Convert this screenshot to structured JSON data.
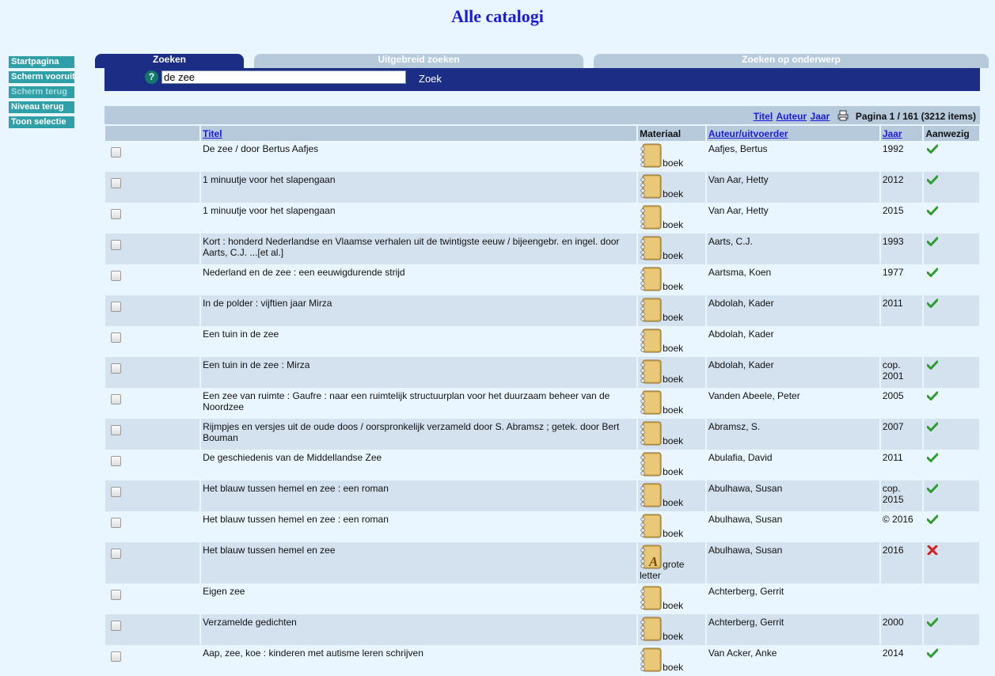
{
  "page_title": "Alle catalogi",
  "sidebar": {
    "items": [
      {
        "label": "Startpagina",
        "enabled": true
      },
      {
        "label": "Scherm vooruit",
        "enabled": true
      },
      {
        "label": "Scherm terug",
        "enabled": false
      },
      {
        "label": "Niveau terug",
        "enabled": true
      },
      {
        "label": "Toon selectie",
        "enabled": true
      }
    ]
  },
  "tabs": [
    {
      "label": "Zoeken",
      "active": true
    },
    {
      "label": "Uitgebreid zoeken",
      "active": false
    },
    {
      "label": "Zoeken op onderwerp",
      "active": false
    }
  ],
  "search": {
    "help": "?",
    "value": "de zee",
    "button": "Zoek"
  },
  "results_bar": {
    "sort_titel": "Titel",
    "sort_auteur": "Auteur",
    "sort_jaar": "Jaar",
    "pagination": "Pagina 1 / 161 (3212 items)"
  },
  "columns": {
    "titel": "Titel",
    "materiaal": "Materiaal",
    "auteur": "Auteur/uitvoerder",
    "jaar": "Jaar",
    "aanwezig": "Aanwezig"
  },
  "colors": {
    "accent": "#1c2d86",
    "teal": "#30a0a8",
    "available": "#2e9c2e",
    "unavailable": "#d42020"
  },
  "rows": [
    {
      "title": "De zee / door Bertus Aafjes",
      "material": "boek",
      "material_icon": "book-icon",
      "author": "Aafjes, Bertus",
      "year": "1992",
      "status": "available"
    },
    {
      "title": "1 minuutje voor het slapengaan",
      "material": "boek",
      "material_icon": "book-icon",
      "author": "Van Aar, Hetty",
      "year": "2012",
      "status": "available"
    },
    {
      "title": "1 minuutje voor het slapengaan",
      "material": "boek",
      "material_icon": "book-icon",
      "author": "Van Aar, Hetty",
      "year": "2015",
      "status": "available"
    },
    {
      "title": "Kort : honderd Nederlandse en Vlaamse verhalen uit de twintigste eeuw / bijeengebr. en ingel. door Aarts, C.J. ...[et al.]",
      "material": "boek",
      "material_icon": "book-icon",
      "author": "Aarts, C.J.",
      "year": "1993",
      "status": "available"
    },
    {
      "title": "Nederland en de zee : een eeuwigdurende strijd",
      "material": "boek",
      "material_icon": "book-icon",
      "author": "Aartsma, Koen",
      "year": "1977",
      "status": "available"
    },
    {
      "title": "In de polder : vijftien jaar Mirza",
      "material": "boek",
      "material_icon": "book-icon",
      "author": "Abdolah, Kader",
      "year": "2011",
      "status": "available"
    },
    {
      "title": "Een tuin in de zee",
      "material": "boek",
      "material_icon": "book-icon",
      "author": "Abdolah, Kader",
      "year": "",
      "status": "none"
    },
    {
      "title": "Een tuin in de zee : Mirza",
      "material": "boek",
      "material_icon": "book-icon",
      "author": "Abdolah, Kader",
      "year": "cop. 2001",
      "status": "available"
    },
    {
      "title": "Een zee van ruimte : Gaufre : naar een ruimtelijk structuurplan voor het duurzaam beheer van de Noordzee",
      "material": "boek",
      "material_icon": "book-icon",
      "author": "Vanden Abeele, Peter",
      "year": "2005",
      "status": "available"
    },
    {
      "title": "Rijmpjes en versjes uit de oude doos / oorspronkelijk verzameld door S. Abramsz ; getek. door Bert Bouman",
      "material": "boek",
      "material_icon": "book-icon",
      "author": "Abramsz, S.",
      "year": "2007",
      "status": "available"
    },
    {
      "title": "De geschiedenis van de Middellandse Zee",
      "material": "boek",
      "material_icon": "book-icon",
      "author": "Abulafia, David",
      "year": "2011",
      "status": "available"
    },
    {
      "title": "Het blauw tussen hemel en zee : een roman",
      "material": "boek",
      "material_icon": "book-icon",
      "author": "Abulhawa, Susan",
      "year": "cop. 2015",
      "status": "available"
    },
    {
      "title": "Het blauw tussen hemel en zee : een roman",
      "material": "boek",
      "material_icon": "book-icon",
      "author": "Abulhawa, Susan",
      "year": "© 2016",
      "status": "available"
    },
    {
      "title": "Het blauw tussen hemel en zee",
      "material": "grote letter",
      "material_icon": "large-print-book-icon",
      "author": "Abulhawa, Susan",
      "year": "2016",
      "status": "unavailable"
    },
    {
      "title": "Eigen zee",
      "material": "boek",
      "material_icon": "book-icon",
      "author": "Achterberg, Gerrit",
      "year": "",
      "status": "none"
    },
    {
      "title": "Verzamelde gedichten",
      "material": "boek",
      "material_icon": "book-icon",
      "author": "Achterberg, Gerrit",
      "year": "2000",
      "status": "available"
    },
    {
      "title": "Aap, zee, koe : kinderen met autisme leren schrijven",
      "material": "boek",
      "material_icon": "book-icon",
      "author": "Van Acker, Anke",
      "year": "2014",
      "status": "available"
    }
  ]
}
